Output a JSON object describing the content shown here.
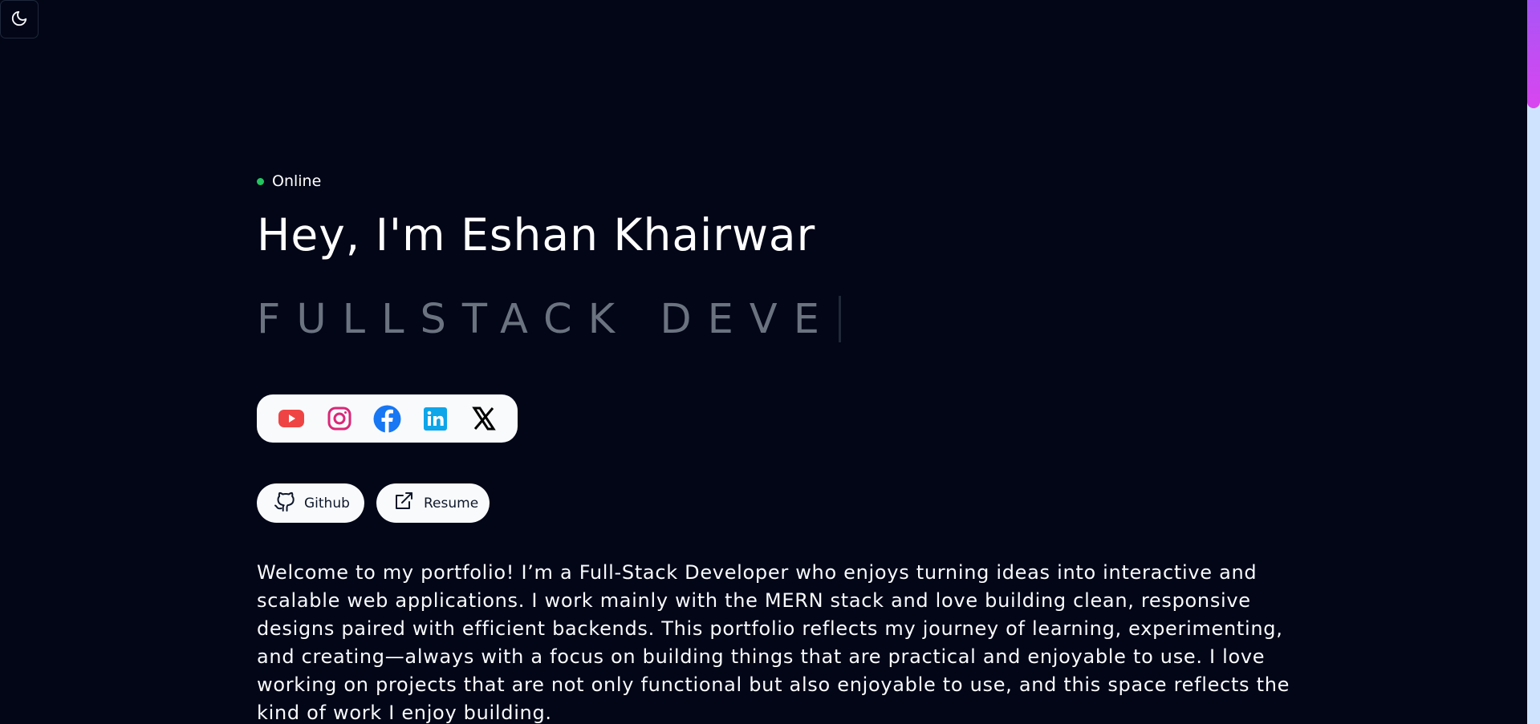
{
  "theme_toggle": {
    "icon": "moon-icon"
  },
  "status": {
    "label": "Online",
    "color": "#22c55e"
  },
  "hero": {
    "title": "Hey, I'm Eshan Khairwar",
    "typed_text": "FULLSTACK DEVE"
  },
  "social_links": [
    {
      "name": "youtube",
      "icon": "youtube-icon",
      "color": "#ef4444"
    },
    {
      "name": "instagram",
      "icon": "instagram-icon",
      "color": "#db2777"
    },
    {
      "name": "facebook",
      "icon": "facebook-icon",
      "color": "#1877f2"
    },
    {
      "name": "linkedin",
      "icon": "linkedin-icon",
      "color": "#0ea5e9"
    },
    {
      "name": "x",
      "icon": "x-icon",
      "color": "#000000"
    }
  ],
  "actions": {
    "github_label": "Github",
    "resume_label": "Resume"
  },
  "intro": {
    "text": "Welcome to my portfolio! I’m a Full-Stack Developer who enjoys turning ideas into interactive and scalable web applications. I work mainly with the MERN stack and love building clean, responsive designs paired with efficient backends. This portfolio reflects my journey of learning, experimenting, and creating—always with a focus on building things that are practical and enjoyable to use. I love working on projects that are not only functional but also enjoyable to use, and this space reflects the kind of work I enjoy building."
  },
  "colors": {
    "background": "#020617",
    "panel": "#f8fafc",
    "scrollbar_track": "#cfe3ff",
    "scrollbar_thumb_start": "#a855f7",
    "scrollbar_thumb_end": "#d946ef",
    "typed_text": "#6b7280"
  }
}
